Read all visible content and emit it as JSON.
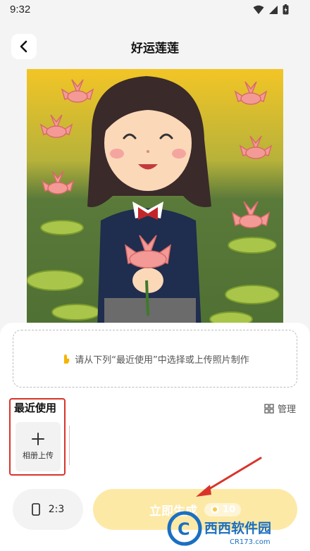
{
  "status": {
    "time": "9:32"
  },
  "header": {
    "title": "好运莲莲"
  },
  "upload": {
    "hint": "请从下列“最近使用”中选择或上传照片制作"
  },
  "recent": {
    "title": "最近使用",
    "manage_label": "管理",
    "album_upload_label": "相册上传"
  },
  "ratio": {
    "label": "2:3"
  },
  "generate": {
    "label": "立即生成",
    "cost": "10"
  },
  "watermark": {
    "text": "西西软件园",
    "sub": "CR173.com"
  },
  "colors": {
    "accent": "#fde9a6",
    "highlight": "#d9342b",
    "pond": "#5a7a3a",
    "sky": "#f2c526"
  }
}
